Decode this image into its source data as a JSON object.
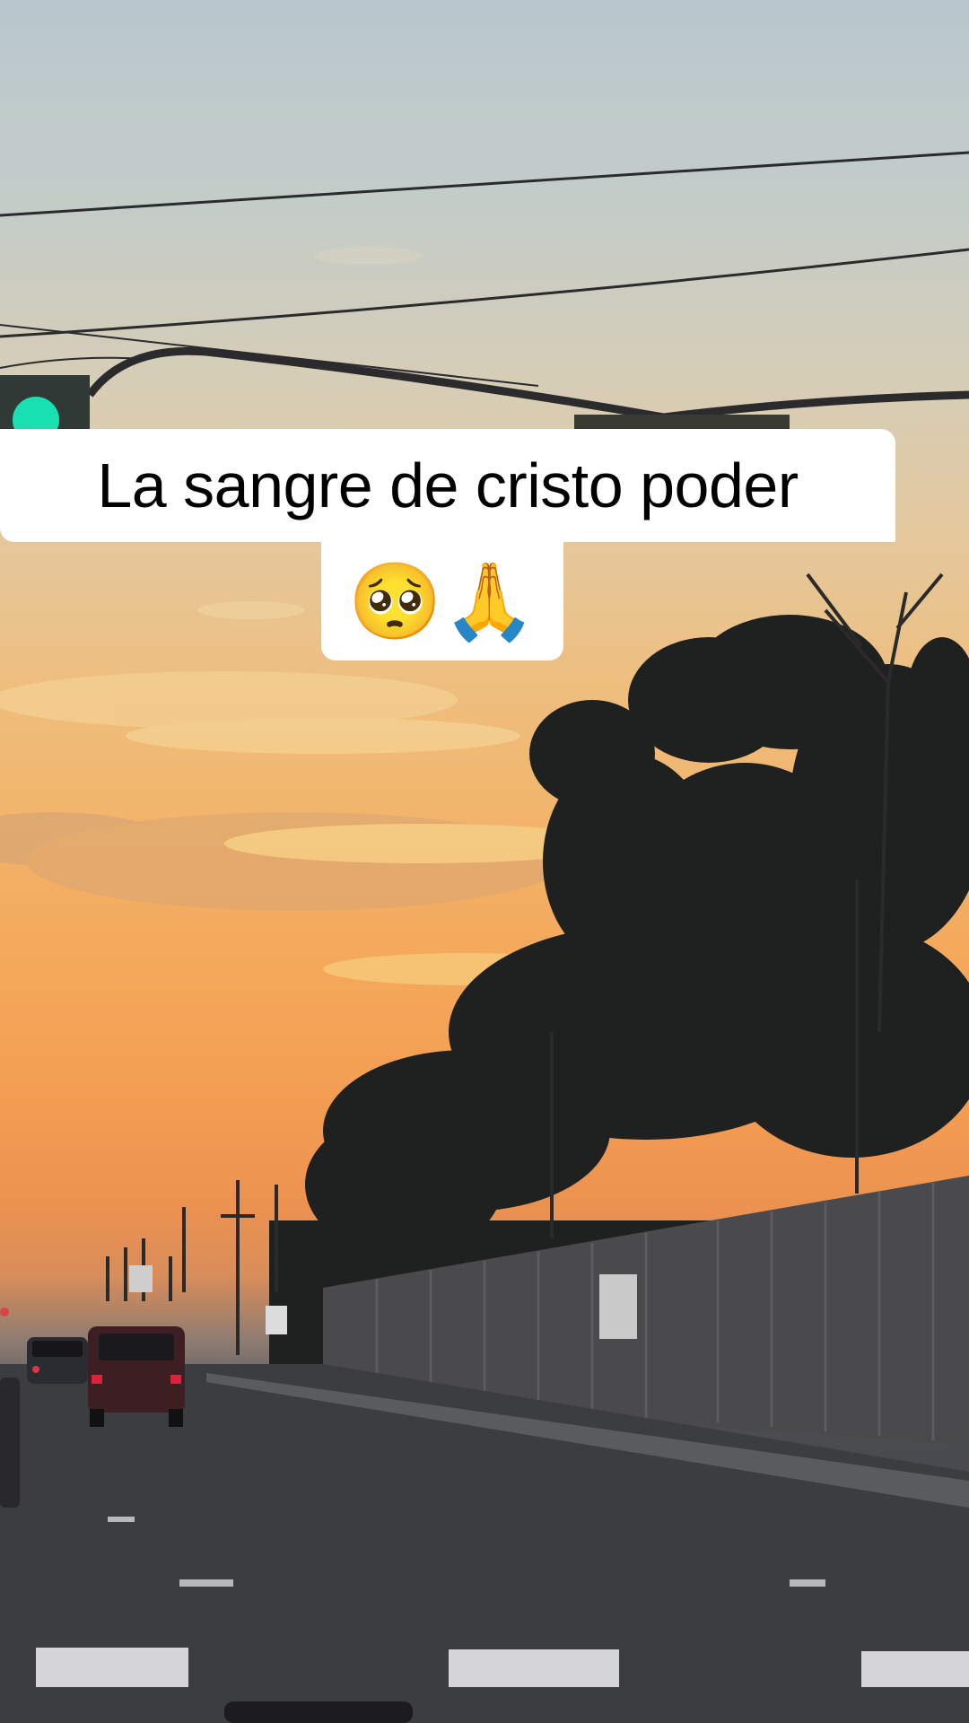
{
  "caption": {
    "line1": "La sangre de cristo poder",
    "line2": "🥺🙏"
  },
  "colors": {
    "sky_top": "#b9c7cf",
    "sky_sunset": "#f4a85a",
    "road": "#3b3c40",
    "caption_bg": "#ffffff",
    "caption_text": "#000000",
    "traffic_light_green": "#19e0b0"
  },
  "scene_elements": [
    "traffic-light",
    "power-lines",
    "tree-silhouettes",
    "utility-poles",
    "sound-wall",
    "cars",
    "road",
    "crosswalk"
  ]
}
